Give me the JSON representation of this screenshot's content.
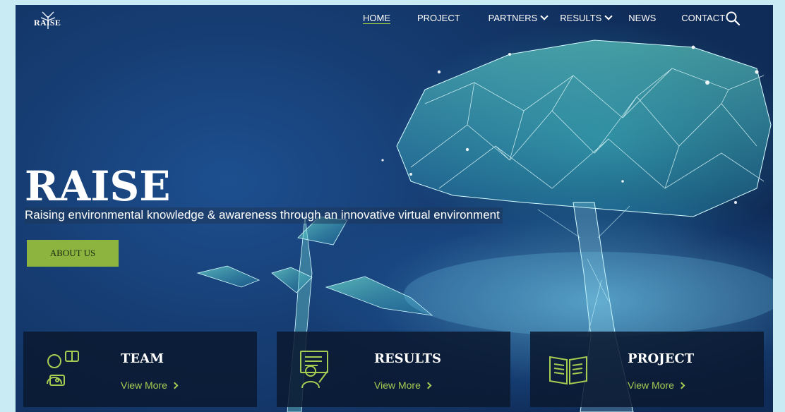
{
  "brand": {
    "logo_text": "RAISE"
  },
  "nav": {
    "items": [
      {
        "label": "HOME",
        "active": true
      },
      {
        "label": "PROJECT"
      },
      {
        "label": "PARTNERS",
        "has_dropdown": true
      },
      {
        "label": "RESULTS",
        "has_dropdown": true
      },
      {
        "label": "NEWS"
      },
      {
        "label": "CONTACT"
      }
    ],
    "search_icon": "search-icon",
    "active_underline_color": "#9dc347"
  },
  "hero": {
    "title": "RAISE",
    "subtitle": "Raising environmental knowledge & awareness through an innovative virtual environment",
    "button_label": "ABOUT US",
    "button_color": "#8cb43f"
  },
  "cards": [
    {
      "title": "TEAM",
      "link_label": "View More",
      "icon": "team-icon"
    },
    {
      "title": "RESULTS",
      "link_label": "View More",
      "icon": "results-icon"
    },
    {
      "title": "PROJECT",
      "link_label": "View More",
      "icon": "project-book-icon"
    }
  ],
  "colors": {
    "accent": "#a6cc52",
    "background": "#163d73"
  }
}
